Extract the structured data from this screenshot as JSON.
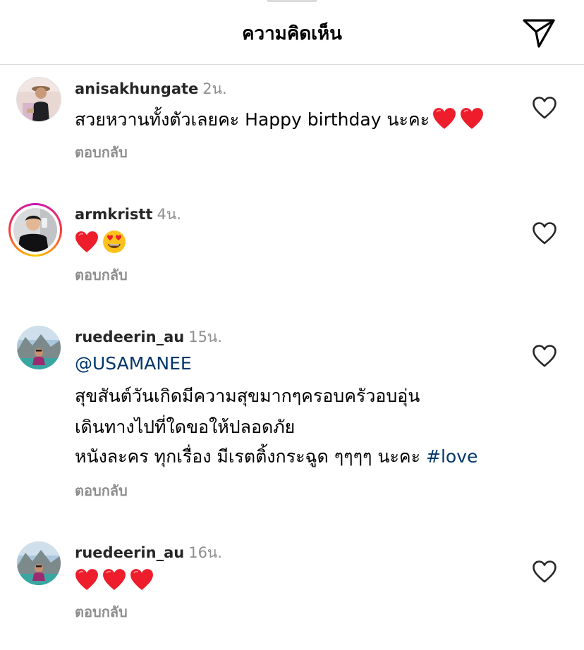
{
  "header": {
    "title": "ความคิดเห็น",
    "share_icon": "paper-plane-icon"
  },
  "colors": {
    "username": "#262626",
    "meta_gray": "#8e8e8e",
    "link_blue": "#00376b",
    "divider": "#dbdbdb",
    "heart_red": "#ed1d2b"
  },
  "comments": [
    {
      "username": "anisakhungate",
      "time": "2น.",
      "text": "สวยหวานทั้งตัวเลยคะ Happy birthday นะคะ",
      "trailing_emojis": [
        "red-heart-emoji",
        "red-heart-emoji"
      ],
      "reply_label": "ตอบกลับ",
      "like_icon": "heart-outline-icon"
    },
    {
      "username": "armkristt",
      "time": "4น.",
      "emojis": [
        "red-heart-emoji",
        "heart-eyes-emoji"
      ],
      "has_story_ring": true,
      "reply_label": "ตอบกลับ",
      "like_icon": "heart-outline-icon"
    },
    {
      "username": "ruedeerin_au",
      "time": "15น.",
      "mention": "@USAMANEE",
      "lines": [
        "สุขสันต์วันเกิดมีความสุขมากๆครอบครัวอบอุ่น",
        "เดินทางไปที่ใดขอให้ปลอดภัย",
        "หนังละคร ทุกเรื่อง มีเรตติ้งกระฉูด ๆๆๆๆ นะคะ"
      ],
      "hashtag": "#love",
      "reply_label": "ตอบกลับ",
      "like_icon": "heart-outline-icon"
    },
    {
      "username": "ruedeerin_au",
      "time": "16น.",
      "emojis": [
        "red-heart-emoji",
        "red-heart-emoji",
        "red-heart-emoji"
      ],
      "reply_label": "ตอบกลับ",
      "like_icon": "heart-outline-icon"
    }
  ]
}
